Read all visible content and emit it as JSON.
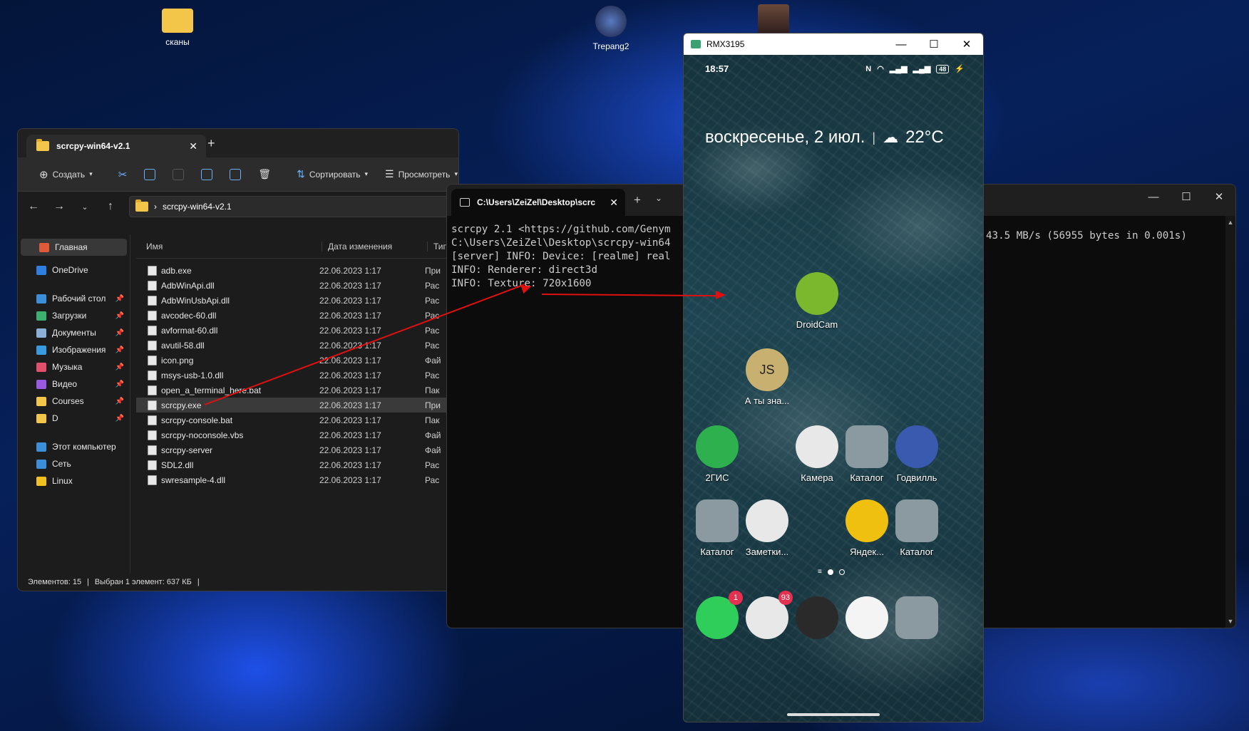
{
  "desktop": {
    "icons": [
      {
        "label": "сканы",
        "icon": "folder-icon"
      },
      {
        "label": "Trepang2",
        "icon": "game-icon"
      }
    ]
  },
  "explorer": {
    "tab_title": "scrcpy-win64-v2.1",
    "toolbar": {
      "create": "Создать",
      "sort": "Сортировать",
      "view": "Просмотреть"
    },
    "path": "scrcpy-win64-v2.1",
    "sidebar": [
      {
        "label": "Главная",
        "color": "#e05a3a"
      },
      {
        "label": "OneDrive",
        "color": "#2f7fe0"
      },
      {
        "label": "Рабочий стол",
        "color": "#3a8fd8"
      },
      {
        "label": "Загрузки",
        "color": "#3db070"
      },
      {
        "label": "Документы",
        "color": "#8ab0d8"
      },
      {
        "label": "Изображения",
        "color": "#3a9ae0"
      },
      {
        "label": "Музыка",
        "color": "#e0506a"
      },
      {
        "label": "Видео",
        "color": "#9a5ae0"
      },
      {
        "label": "Courses",
        "color": "#f3c549"
      },
      {
        "label": "D",
        "color": "#f3c549"
      },
      {
        "label": "Этот компьютер",
        "color": "#3a8fd8"
      },
      {
        "label": "Сеть",
        "color": "#3a8fd8"
      },
      {
        "label": "Linux",
        "color": "#f0c020"
      }
    ],
    "columns": {
      "name": "Имя",
      "date": "Дата изменения",
      "type": "Тип"
    },
    "files": [
      {
        "name": "adb.exe",
        "date": "22.06.2023 1:17",
        "type": "При"
      },
      {
        "name": "AdbWinApi.dll",
        "date": "22.06.2023 1:17",
        "type": "Рас"
      },
      {
        "name": "AdbWinUsbApi.dll",
        "date": "22.06.2023 1:17",
        "type": "Рас"
      },
      {
        "name": "avcodec-60.dll",
        "date": "22.06.2023 1:17",
        "type": "Рас"
      },
      {
        "name": "avformat-60.dll",
        "date": "22.06.2023 1:17",
        "type": "Рас"
      },
      {
        "name": "avutil-58.dll",
        "date": "22.06.2023 1:17",
        "type": "Рас"
      },
      {
        "name": "icon.png",
        "date": "22.06.2023 1:17",
        "type": "Фай"
      },
      {
        "name": "msys-usb-1.0.dll",
        "date": "22.06.2023 1:17",
        "type": "Рас"
      },
      {
        "name": "open_a_terminal_here.bat",
        "date": "22.06.2023 1:17",
        "type": "Пак"
      },
      {
        "name": "scrcpy.exe",
        "date": "22.06.2023 1:17",
        "type": "При"
      },
      {
        "name": "scrcpy-console.bat",
        "date": "22.06.2023 1:17",
        "type": "Пак"
      },
      {
        "name": "scrcpy-noconsole.vbs",
        "date": "22.06.2023 1:17",
        "type": "Фай"
      },
      {
        "name": "scrcpy-server",
        "date": "22.06.2023 1:17",
        "type": "Фай"
      },
      {
        "name": "SDL2.dll",
        "date": "22.06.2023 1:17",
        "type": "Рас"
      },
      {
        "name": "swresample-4.dll",
        "date": "22.06.2023 1:17",
        "type": "Рас"
      }
    ],
    "status_count": "Элементов: 15",
    "status_selected": "Выбран 1 элемент: 637 КБ"
  },
  "terminal": {
    "tab_title": "C:\\Users\\ZeiZel\\Desktop\\scrc",
    "lines": [
      "scrcpy 2.1 <https://github.com/Genym",
      "C:\\Users\\ZeiZel\\Desktop\\scrcpy-win64",
      "[server] INFO: Device: [realme] real",
      "INFO: Renderer: direct3d",
      "INFO: Texture: 720x1600"
    ],
    "right_line": "43.5 MB/s (56955 bytes in 0.001s)"
  },
  "phone": {
    "window_title": "RMX3195",
    "time": "18:57",
    "battery": "48",
    "date": "воскресенье, 2 июл.",
    "weather": "22°C",
    "apps": [
      {
        "label": "DroidCam",
        "color": "#7cb82e"
      },
      {
        "label": "А ты зна...",
        "color": "#c8b070",
        "glyph": "JS"
      },
      {
        "label": "2ГИС",
        "color": "#2fb04f"
      },
      {
        "label": "Камера",
        "color": "#e8e8e8"
      },
      {
        "label": "Каталог",
        "color": "#8a9aa0"
      },
      {
        "label": "Годвилль",
        "color": "#3a5ab0"
      },
      {
        "label": "Каталог",
        "color": "#8a9aa0"
      },
      {
        "label": "Заметки...",
        "color": "#e8e8e8"
      },
      {
        "label": "Яндек...",
        "color": "#f0c010"
      },
      {
        "label": "Каталог",
        "color": "#8a9aa0"
      }
    ],
    "dock": [
      {
        "name": "phone",
        "color": "#2fce5a",
        "badge": "1"
      },
      {
        "name": "messages",
        "color": "#e8e8e8",
        "badge": "93"
      },
      {
        "name": "camera-app",
        "color": "#2a2a2a",
        "badge": ""
      },
      {
        "name": "opera",
        "color": "#f4f4f4",
        "badge": ""
      },
      {
        "name": "folder",
        "color": "#8a9aa0",
        "badge": ""
      }
    ]
  }
}
